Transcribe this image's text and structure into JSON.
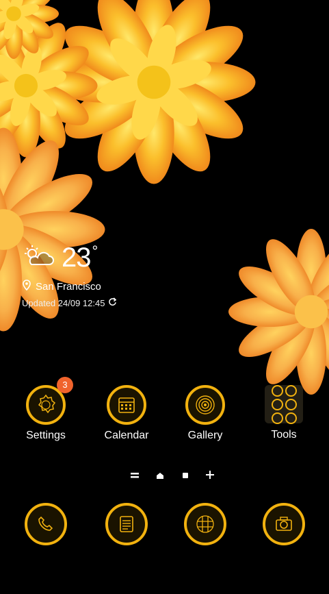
{
  "weather": {
    "condition_icon": "partly-cloudy-icon",
    "temperature": "23",
    "degree_symbol": "°",
    "location": "San Francisco",
    "updated": "Updated 24/09 12:45"
  },
  "apps": [
    {
      "label": "Settings",
      "icon": "gear-icon",
      "badge": "3"
    },
    {
      "label": "Calendar",
      "icon": "calendar-icon"
    },
    {
      "label": "Gallery",
      "icon": "flower-icon"
    },
    {
      "label": "Tools",
      "icon": "tools-folder-icon"
    }
  ],
  "page_indicator": {
    "items": [
      "=",
      "home",
      "•",
      "+"
    ],
    "current_index": 2
  },
  "dock": [
    {
      "icon": "phone-icon"
    },
    {
      "icon": "messages-icon"
    },
    {
      "icon": "app-drawer-icon"
    },
    {
      "icon": "camera-icon"
    }
  ],
  "colors": {
    "accent": "#f2b20f",
    "badge": "#f0632c",
    "background": "#000000"
  }
}
